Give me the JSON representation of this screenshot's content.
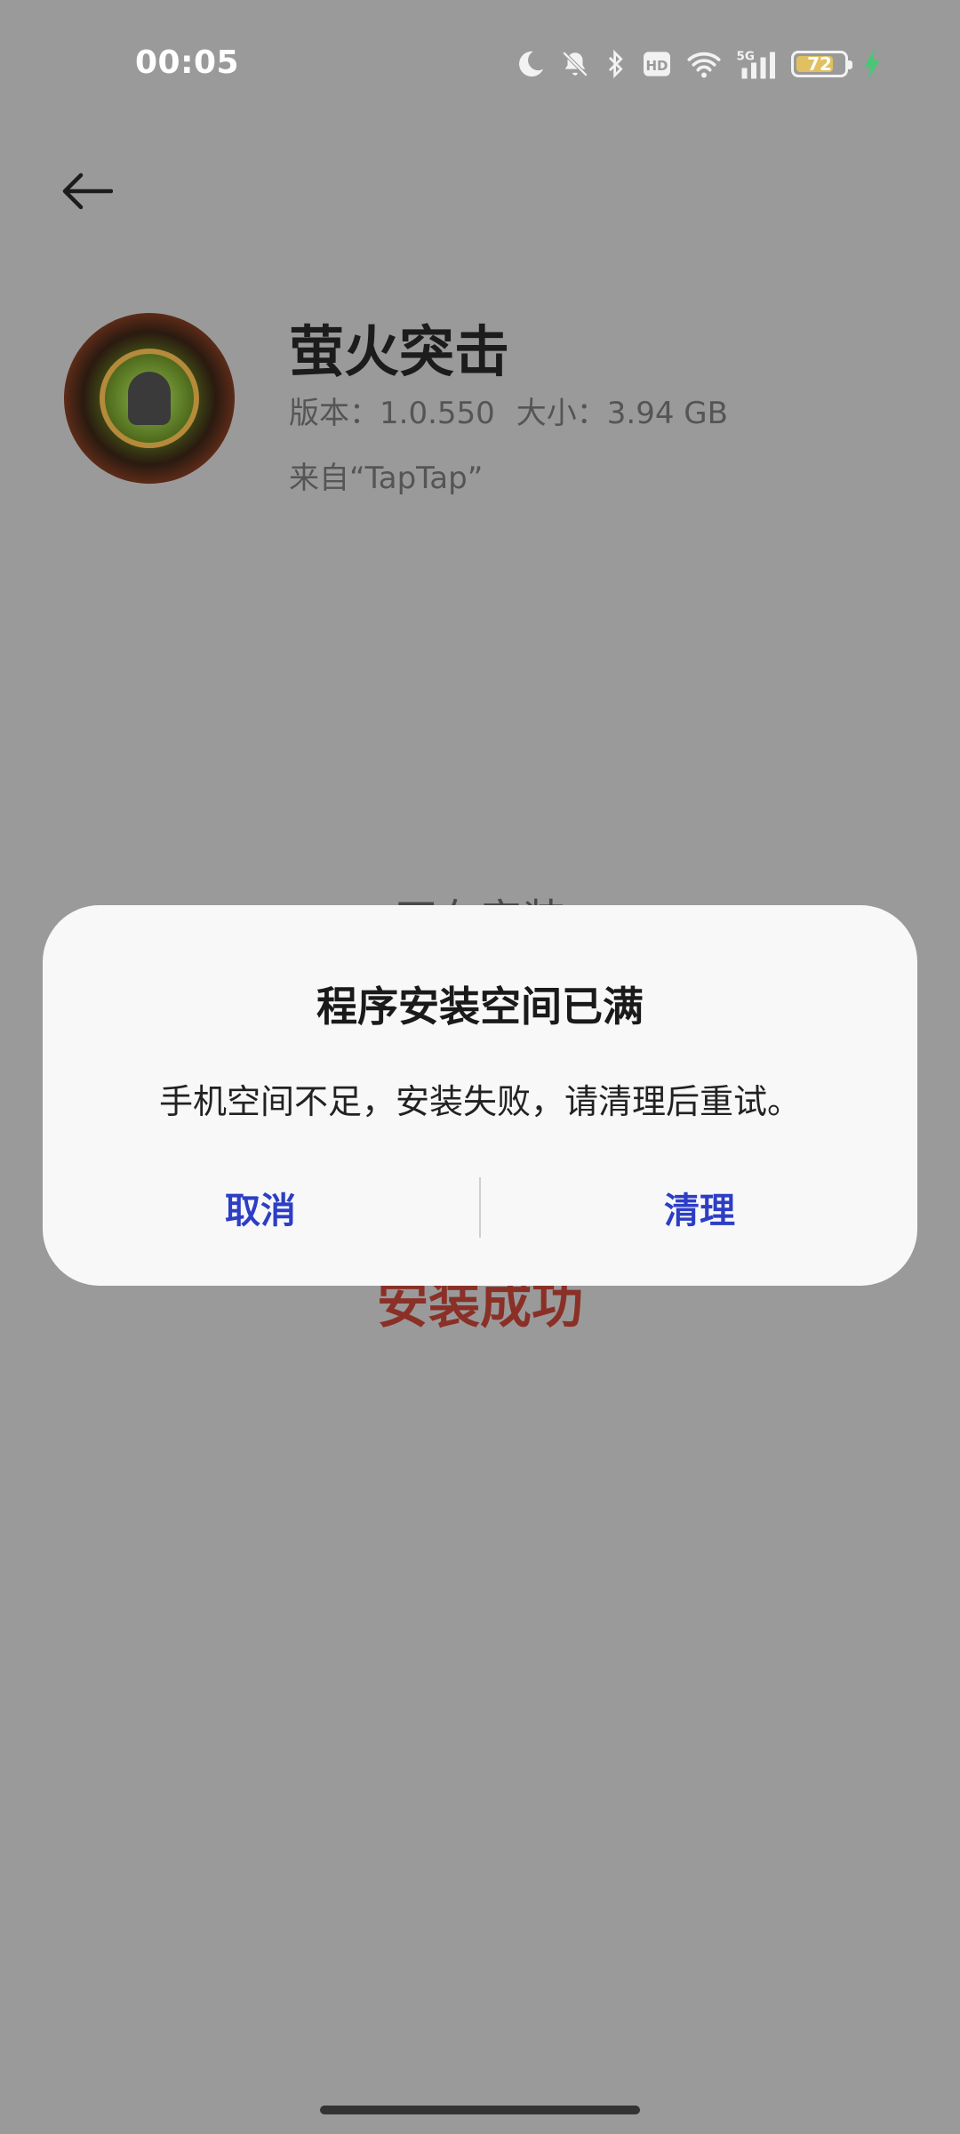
{
  "status_bar": {
    "time": "00:05",
    "battery_level": "72",
    "icons": [
      "moon-icon",
      "bell-off-icon",
      "bluetooth-icon",
      "hd-icon",
      "wifi-icon",
      "5g-signal-icon",
      "battery-icon",
      "charging-icon"
    ],
    "colors": {
      "icon": "#f2f2f2",
      "battery_fill": "#e0c060",
      "charging": "#48c774"
    }
  },
  "app": {
    "name": "萤火突击",
    "version": "版本：1.0.550",
    "size": "大小：3.94 GB",
    "source": "来自“TapTap”"
  },
  "background_status": {
    "installing": "正在安装",
    "success": "安装成功"
  },
  "dialog": {
    "title": "程序安装空间已满",
    "message": "手机空间不足，安装失败，请清理后重试。",
    "cancel_label": "取消",
    "clean_label": "清理"
  },
  "colors": {
    "overlay_bg": "#9a9a9a",
    "dialog_bg": "#f8f8f8",
    "button_text": "#2d3ec5",
    "success_text": "#8a3027"
  }
}
